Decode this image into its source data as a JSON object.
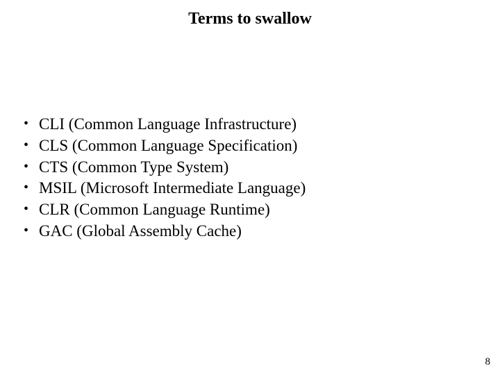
{
  "title": "Terms to swallow",
  "bullets": [
    "CLI (Common Language Infrastructure)",
    "CLS (Common Language Specification)",
    "CTS (Common Type System)",
    "MSIL (Microsoft Intermediate Language)",
    "CLR (Common Language Runtime)",
    "GAC (Global Assembly Cache)"
  ],
  "page_number": "8"
}
